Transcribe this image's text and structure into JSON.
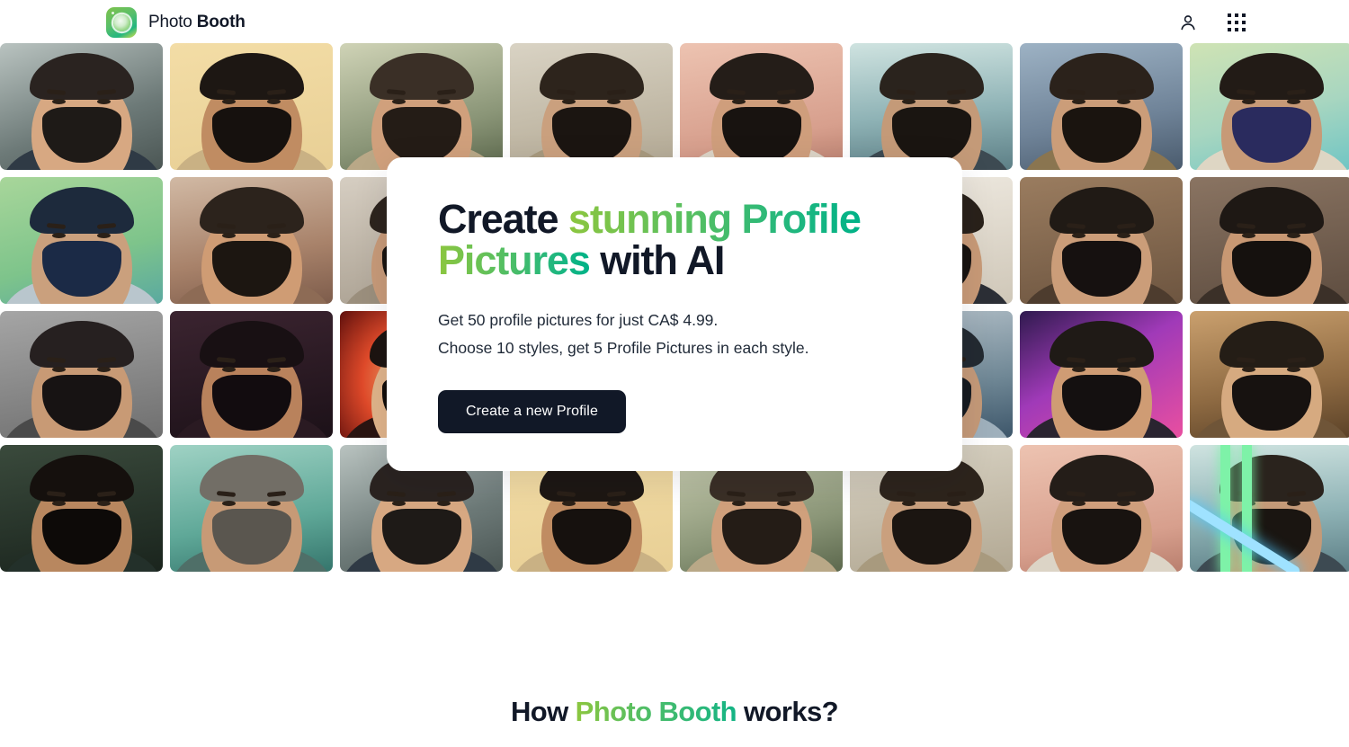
{
  "header": {
    "brand_name_thin": "Photo ",
    "brand_name_bold": "Booth",
    "logo_icon": "photo-booth-lens-logo",
    "account_icon": "user-icon",
    "apps_icon": "apps-grid-icon"
  },
  "hero": {
    "title_part1": "Create ",
    "title_gradient1": "stunning Profile",
    "title_gradient2": "Pictures",
    "title_part2": " with AI",
    "subtitle_line1": "Get 50 profile pictures for just CA$ 4.99.",
    "subtitle_line2": "Choose 10 styles, get 5 Profile Pictures in each style.",
    "cta_label": "Create a new Profile"
  },
  "works": {
    "title_prefix": "How ",
    "title_gradient": "Photo Booth",
    "title_suffix": " works?"
  },
  "colors": {
    "gradient_start": "#8cc63f",
    "gradient_end": "#00b288",
    "dark": "#111827",
    "card_bg": "#ffffff"
  },
  "gallery": {
    "alt": "AI generated profile picture",
    "tiles": [
      {
        "bg": "linear-gradient(160deg,#b9c3c0,#6d7a78 60%,#4b5654)",
        "skin": "#d7a882",
        "hair": "#2a2320",
        "beard": "#1e1a17",
        "cloth": "#2f3a45",
        "collar": true
      },
      {
        "bg": "linear-gradient(170deg,#f3dda6,#e8cf95)",
        "skin": "#c08c62",
        "hair": "#1d1713",
        "beard": "#16110e",
        "cloth": "#c9b184",
        "collar": false
      },
      {
        "bg": "linear-gradient(165deg,#cfd3b6,#8a9577 65%,#5c684d)",
        "skin": "#d0a07c",
        "hair": "#3a2f26",
        "beard": "#241c16",
        "cloth": "#b9a887",
        "collar": true
      },
      {
        "bg": "linear-gradient(170deg,#d9d3c4,#b2a893)",
        "skin": "#caa07e",
        "hair": "#2d241c",
        "beard": "#1b1511",
        "cloth": "#a89a7e",
        "collar": true
      },
      {
        "bg": "linear-gradient(170deg,#edc3b1,#d79f8d 70%,#b97f6e)",
        "skin": "#cf9e7c",
        "hair": "#241d18",
        "beard": "#181310",
        "cloth": "#dcd4c6",
        "collar": true
      },
      {
        "bg": "linear-gradient(175deg,#cfe3e0,#8fb3b6 55%,#5d7f86)",
        "skin": "#c49a78",
        "hair": "#2a231d",
        "beard": "#1a1511",
        "cloth": "#3d4a52",
        "collar": false
      },
      {
        "bg": "linear-gradient(170deg,#9db2c4,#6f8398 60%,#4a5b6d)",
        "skin": "#cb9d79",
        "hair": "#2b221b",
        "beard": "#1a140f",
        "cloth": "#8a7550",
        "collar": false
      },
      {
        "bg": "linear-gradient(165deg,#cfe3b4,#a8d6c0 55%,#6fc5c4)",
        "skin": "#c79a77",
        "hair": "#221b16",
        "beard": "#2a2b5e",
        "cloth": "#ded6c4",
        "collar": true
      },
      {
        "bg": "linear-gradient(165deg,#a8d69a,#7ec48b 60%,#5aa9a0)",
        "skin": "#caa07d",
        "hair": "#1d2a3c",
        "beard": "#1b2a46",
        "cloth": "#b9c6cd",
        "collar": true
      },
      {
        "bg": "linear-gradient(170deg,#d1b9a4,#a8826a 60%,#7d5c4b)",
        "skin": "#cf9c74",
        "hair": "#2c231c",
        "beard": "#1c1611",
        "cloth": "#8d6b55",
        "collar": false
      },
      {
        "bg": "linear-gradient(170deg,#d6cec2,#a79d8e)",
        "skin": "#c79a78",
        "hair": "#2d241d",
        "beard": "#1a1410",
        "cloth": "#9b8f7d",
        "collar": true
      },
      {
        "bg": "linear-gradient(170deg,#e6dccb,#c2b6a0)",
        "skin": "#ccA07e",
        "hair": "#33281f",
        "beard": "#1f1812",
        "cloth": "#b3a territory",
        "collar": true
      },
      {
        "bg": "linear-gradient(170deg,#dfe3e6,#b4bcc2 60%,#8d969d)",
        "skin": "#c99b78",
        "hair": "#2a221b",
        "beard": "#191410",
        "cloth": "#d8d3ca",
        "collar": true
      },
      {
        "bg": "linear-gradient(170deg,#efeae1,#cfc7b8)",
        "skin": "#c89a77",
        "hair": "#29211a",
        "beard": "#181310",
        "cloth": "#2c2f36",
        "collar": true
      },
      {
        "bg": "linear-gradient(170deg,#9a7c5f,#6d5540)",
        "skin": "#cb9d79",
        "hair": "#201a15",
        "beard": "#161110",
        "cloth": "#4d3c2e",
        "collar": false
      },
      {
        "bg": "linear-gradient(170deg,#8a7462,#5e4d40)",
        "skin": "#c89873",
        "hair": "#1e1814",
        "beard": "#15110e",
        "cloth": "#3b3028",
        "collar": false
      },
      {
        "bg": "linear-gradient(170deg,#a5a5a5,#6f6f6f)",
        "skin": "#c89a75",
        "hair": "#262020",
        "beard": "#171313",
        "cloth": "#4a4a4a",
        "collar": false
      },
      {
        "bg": "linear-gradient(170deg,#3b2430,#1c1118)",
        "skin": "#b9825c",
        "hair": "#181013",
        "beard": "#120c0f",
        "cloth": "#2a1a22",
        "collar": false
      },
      {
        "bg": "radial-gradient(circle at 50% 55%,#ffd88a,#e04a2a 55%,#5e0f0c)",
        "skin": "#e0b48a",
        "hair": "#1c1410",
        "beard": "#120d0a",
        "cloth": "#2a1512",
        "collar": false
      },
      {
        "bg": "linear-gradient(170deg,#dfe6ee,#aab8c6 60%,#7c8d9e)",
        "skin": "#cfa27f",
        "hair": "#2b2a28",
        "beard": "#1b1a18",
        "cloth": "#c4ccd4",
        "collar": false
      },
      {
        "bg": "linear-gradient(170deg,#1f3550,#0c1a2c)",
        "skin": "#9d7354",
        "hair": "#161a22",
        "beard": "#0e1118",
        "cloth": "#16202e",
        "collar": false
      },
      {
        "bg": "linear-gradient(170deg,#b8c4cc,#6f8795 60%,#3d566a)",
        "skin": "#c49978",
        "hair": "#232a31",
        "beard": "#161b20",
        "cloth": "#9fb0bc",
        "collar": false
      },
      {
        "bg": "linear-gradient(150deg,#2f1a4e,#a03ab8 45%,#e94fa0)",
        "skin": "#cf9c74",
        "hair": "#1f1a16",
        "beard": "#141010",
        "cloth": "#2a2430",
        "collar": false
      },
      {
        "bg": "linear-gradient(170deg,#caa06e,#8e6a42 60%,#5b4228)",
        "skin": "#d6aa80",
        "hair": "#241d16",
        "beard": "#171210",
        "cloth": "#6f5538",
        "collar": false
      },
      {
        "bg": "linear-gradient(170deg,#3a4a3c,#1a241d)",
        "skin": "#b8875f",
        "hair": "#15100d",
        "beard": "#0d0a08",
        "cloth": "#23302a",
        "collar": false
      },
      {
        "bg": "linear-gradient(170deg,#9fd2c4,#5fa898 60%,#35756c)",
        "skin": "#c79a76",
        "hair": "#726e66",
        "beard": "#5a564f",
        "cloth": "#4f6f68",
        "collar": false
      }
    ]
  }
}
